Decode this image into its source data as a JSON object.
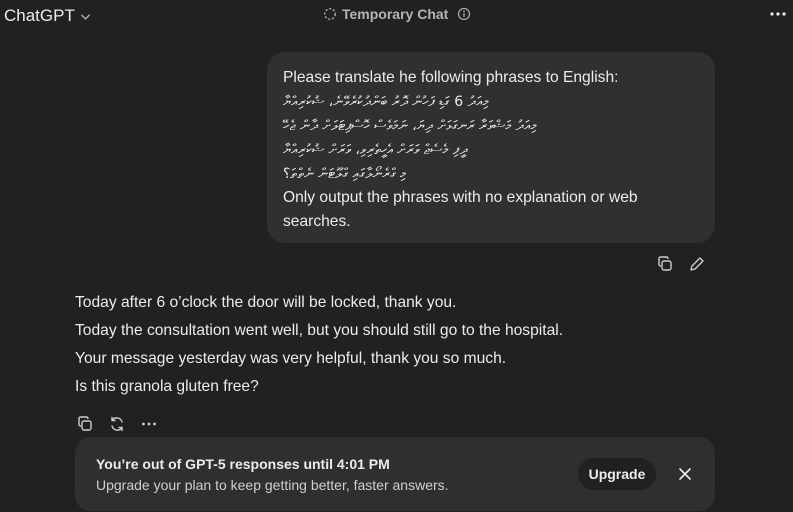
{
  "topbar": {
    "model_label": "ChatGPT",
    "temporary_label": "Temporary Chat",
    "icons": [
      "chevron-down-icon",
      "dashed-circle-icon",
      "info-icon",
      "more-icon"
    ]
  },
  "user_message": {
    "line1": "Please translate he following phrases to English:",
    "dhivehi": [
      "މިއަދު 6 ގަޑި ފަހުން ދޮރު ބަންދުކުރެވޭނެ، ޝުކުރިއްޔާ",
      "މިއަދު މަޝްވަރާ ރަނގަޅަށް ދިޔަ، ނަމަވެސް ހޮސްޕިޓަލަށް ދާން ޖެހޭ",
      "ދީފި މެސެޖް ވަރަށް އެހީތެރިވި، ވަރަށް ޝުކުރިއްޔާ",
      "މި ގްރެނޯލާގައި ގްލޫޓަން ނެތްތަ؟"
    ],
    "line_end": "Only output the phrases with no explanation or web searches."
  },
  "answer": {
    "lines": [
      "Today after 6 o’clock the door will be locked, thank you.",
      "Today the consultation went well, but you should still go to the hospital.",
      "Your message yesterday was very helpful, thank you so much.",
      "Is this granola gluten free?"
    ]
  },
  "banner": {
    "title": "You’re out of GPT-5 responses until 4:01 PM",
    "subtitle": "Upgrade your plan to keep getting better, faster answers.",
    "upgrade_label": "Upgrade"
  },
  "colors": {
    "background": "#212121",
    "bubble": "#303030",
    "banner": "#2f2f2f",
    "text": "#ececec"
  }
}
